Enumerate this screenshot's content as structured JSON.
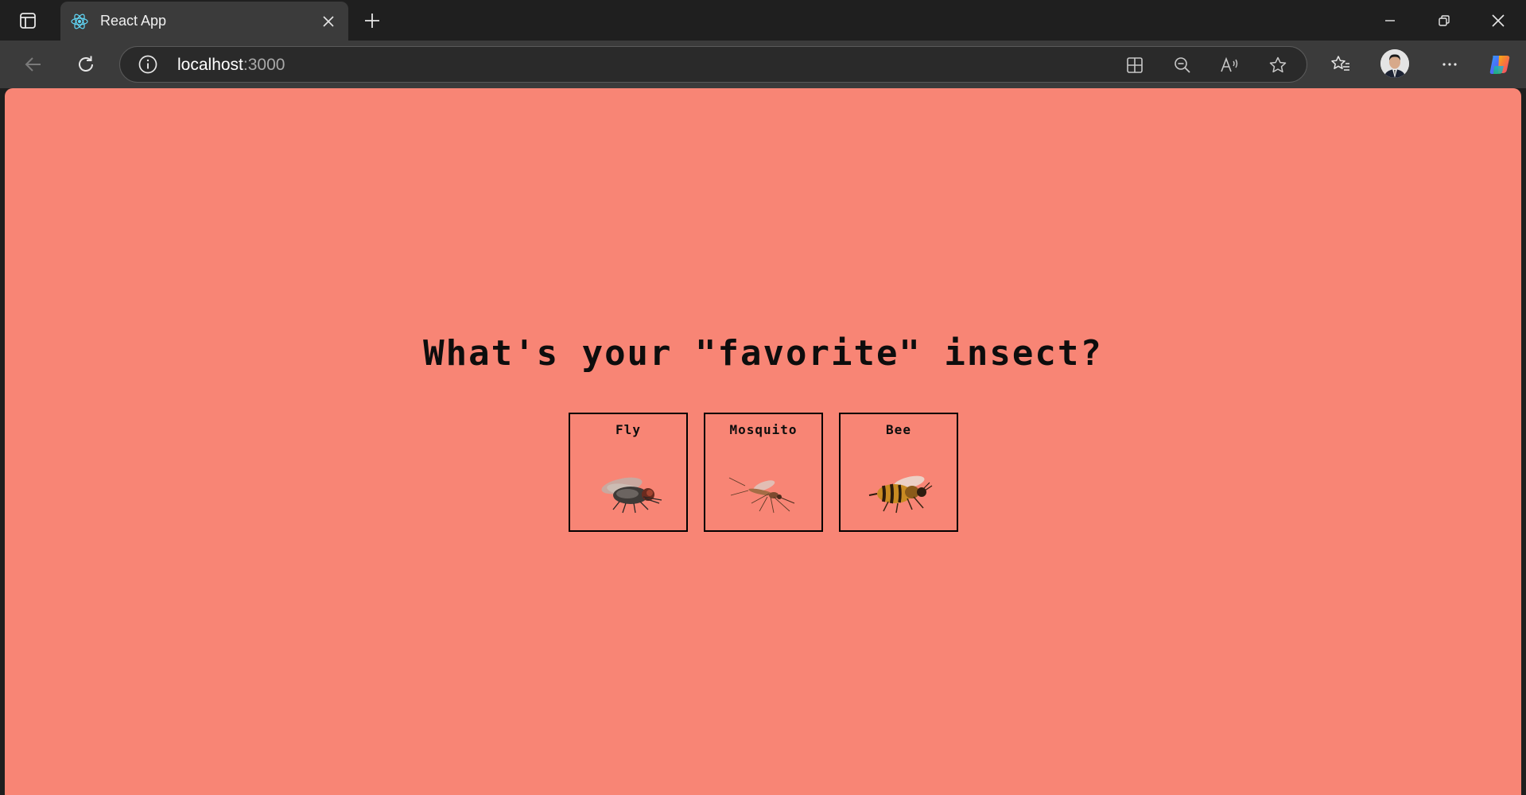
{
  "browser": {
    "tab_title": "React App",
    "url_host": "localhost",
    "url_port": ":3000"
  },
  "page": {
    "background": "#f88575",
    "question": "What's your \"favorite\" insect?",
    "options": [
      {
        "label": "Fly",
        "icon": "fly-image"
      },
      {
        "label": "Mosquito",
        "icon": "mosquito-image"
      },
      {
        "label": "Bee",
        "icon": "bee-image"
      }
    ]
  }
}
